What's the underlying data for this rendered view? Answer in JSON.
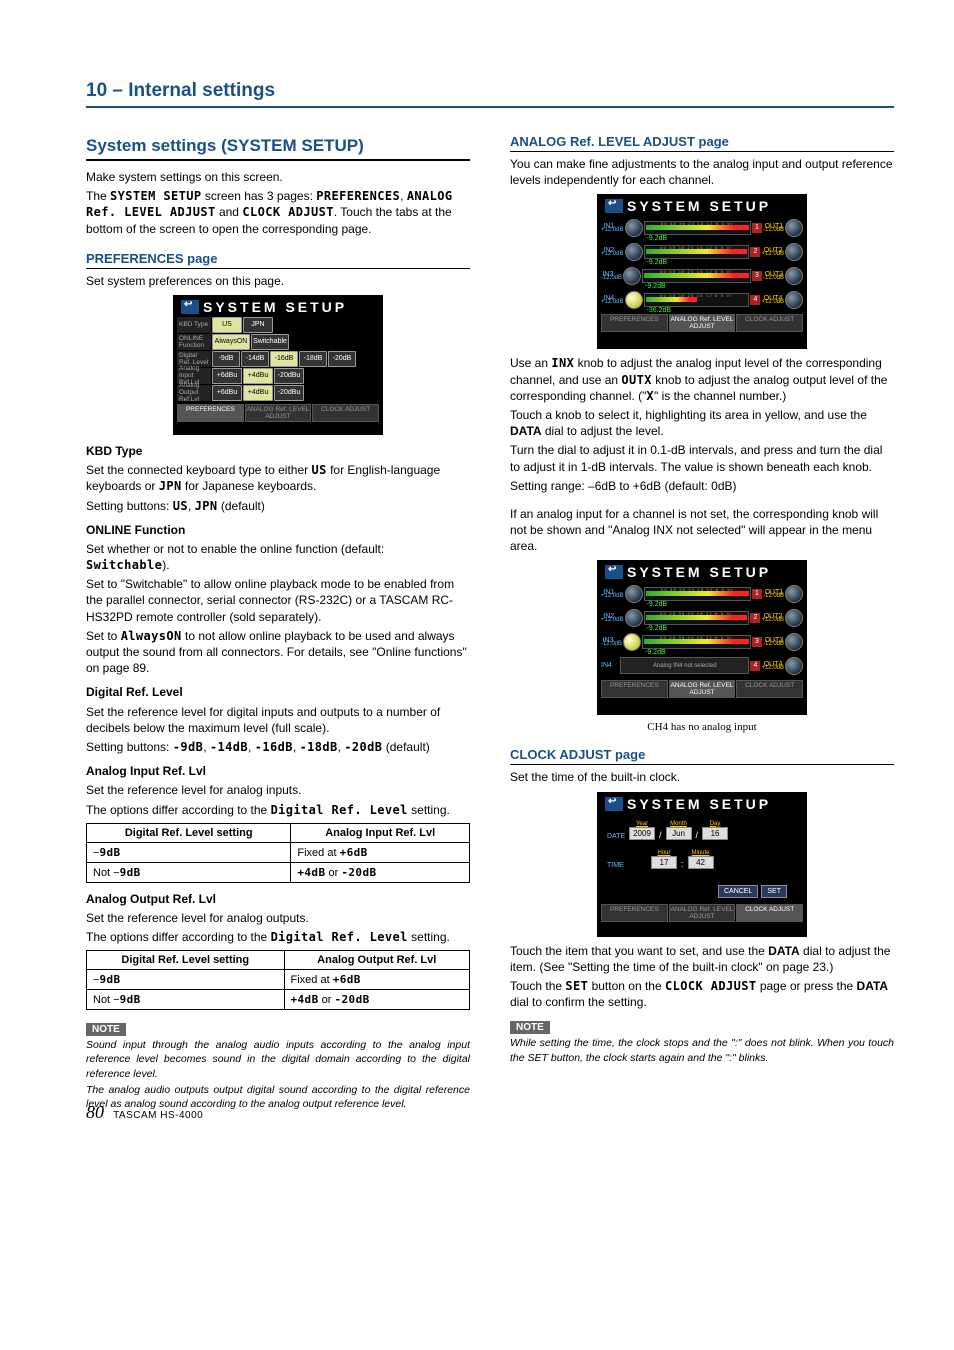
{
  "chapter": "10 – Internal settings",
  "page_number": "80",
  "footer_model": "TASCAM HS-4000",
  "left": {
    "section_title": "System settings (SYSTEM SETUP)",
    "intro1": "Make system settings on this screen.",
    "intro2_a": "The ",
    "intro2_b": "SYSTEM SETUP",
    "intro2_c": " screen has 3 pages: ",
    "intro2_d": "PREFERENCES",
    "intro2_e": ", ",
    "intro2_f": "ANALOG Ref. LEVEL ADJUST",
    "intro2_g": " and ",
    "intro2_h": "CLOCK ADJUST",
    "intro2_i": ". Touch the tabs at the bottom of the screen to open the corresponding page.",
    "prefs_heading": "PREFERENCES page",
    "prefs_lead": "Set system preferences on this page.",
    "ss_title": "SYSTEM SETUP",
    "prefs_rows": {
      "r0": {
        "label": "KBD Type",
        "b0": "US",
        "b1": "JPN"
      },
      "r1": {
        "label": "ONLINE Function",
        "b0": "AlwaysON",
        "b1": "Switchable"
      },
      "r2": {
        "label": "Digital Ref. Level",
        "b0": "-9dB",
        "b1": "-14dB",
        "b2": "-16dB",
        "b3": "-18dB",
        "b4": "-20dB"
      },
      "r3": {
        "label": "Analog Input Ref.Lvl",
        "b0": "+6dBu",
        "b1": "+4dBu",
        "b2": "-20dBu"
      },
      "r4": {
        "label": "Analog Output Ref.Lvl",
        "b0": "+6dBu",
        "b1": "+4dBu",
        "b2": "-20dBu"
      }
    },
    "tabs": {
      "t0": "PREFERENCES",
      "t1": "ANALOG Ref. LEVEL ADJUST",
      "t2": "CLOCK ADJUST"
    },
    "kbd_head": "KBD Type",
    "kbd_p1a": "Set the connected keyboard type to either ",
    "kbd_p1b": "US",
    "kbd_p1c": " for English-language keyboards or ",
    "kbd_p1d": "JPN",
    "kbd_p1e": " for Japanese keyboards.",
    "kbd_p2a": "Setting buttons: ",
    "kbd_p2b": "US",
    "kbd_p2c": ", ",
    "kbd_p2d": "JPN",
    "kbd_p2e": " (default)",
    "online_head": "ONLINE Function",
    "online_p1a": "Set whether or not to enable the online function (default: ",
    "online_p1b": "Switchable",
    "online_p1c": ").",
    "online_p2": "Set to \"Switchable\" to allow online playback mode to be enabled from the parallel connector, serial connector (RS-232C) or a TASCAM RC-HS32PD remote controller (sold separately).",
    "online_p3a": "Set to ",
    "online_p3b": "AlwaysON",
    "online_p3c": " to not allow online playback to be used and always output the sound from all connectors. For details, see \"Online functions\" on page 89.",
    "digref_head": "Digital Ref. Level",
    "digref_p1": "Set the reference level for digital inputs and outputs to a number of decibels below the maximum level (full scale).",
    "digref_p2a": "Setting buttons: ",
    "digref_p2b": "-9dB",
    "digref_p2c": ", ",
    "digref_p2d": "-14dB",
    "digref_p2e": ", ",
    "digref_p2f": "-16dB",
    "digref_p2g": ", ",
    "digref_p2h": "-18dB",
    "digref_p2i": ", ",
    "digref_p2j": "-20dB",
    "digref_p2k": " (default)",
    "ain_head": "Analog Input Ref. Lvl",
    "ain_p1": "Set the reference level for analog inputs.",
    "ain_p2a": "The options differ according to the ",
    "ain_p2b": "Digital Ref. Level",
    "ain_p2c": " setting.",
    "tab1": {
      "h1": "Digital Ref. Level setting",
      "h2": "Analog Input Ref. Lvl",
      "r1c1_prefix": "−",
      "r1c1": "9dB",
      "r1c2a": "Fixed at ",
      "r1c2b": "+6dB",
      "r2c1a": "Not −",
      "r2c1b": "9dB",
      "r2c2a": "+4dB",
      "r2c2b": " or ",
      "r2c2c": "-20dB"
    },
    "aout_head": "Analog Output Ref. Lvl",
    "aout_p1": "Set the reference level for analog outputs.",
    "aout_p2a": "The options differ according to the ",
    "aout_p2b": "Digital Ref. Level",
    "aout_p2c": " setting.",
    "tab2": {
      "h1": "Digital Ref. Level setting",
      "h2": "Analog Output Ref. Lvl",
      "r1c1_prefix": "−",
      "r1c1": "9dB",
      "r1c2a": "Fixed at ",
      "r1c2b": "+6dB",
      "r2c1a": "Not −",
      "r2c1b": "9dB",
      "r2c2a": "+4dB",
      "r2c2b": " or ",
      "r2c2c": "-20dB"
    },
    "note_label": "NOTE",
    "note1": "Sound input through the analog audio inputs according to the analog input reference level becomes sound in the digital domain according to the digital reference level.",
    "note2": "The analog audio outputs output digital sound according to the digital reference level as analog sound according to the analog output reference level."
  },
  "right": {
    "analog_heading": "ANALOG Ref. LEVEL ADJUST page",
    "analog_lead": "You can make fine adjustments to the analog input and output reference levels independently for each channel.",
    "analog_rows": {
      "in1": "IN1",
      "in2": "IN2",
      "in3": "IN3",
      "in4": "IN4",
      "out1": "OUT1",
      "out2": "OUT2",
      "out3": "OUT3",
      "out4": "OUT4",
      "val1": "-9.2dB",
      "val2": "-9.2dB",
      "val3": "-9.2dB",
      "val4": "-36.2dB",
      "sub_p": "+12.0dB",
      "sub_m": "-12.0dB",
      "ticks": "60 48 36 24 18 12 6 0 Vr"
    },
    "analog_p1a": "Use an ",
    "analog_p1b": "INX",
    "analog_p1c": " knob to adjust the analog input level of the corresponding channel, and use an ",
    "analog_p1d": "OUTX",
    "analog_p1e": " knob to adjust the analog output level of the corresponding channel. (\"",
    "analog_p1f": "X",
    "analog_p1g": "\" is the channel number.)",
    "analog_p2": "Touch a knob to select it, highlighting its area in yellow, and use the ",
    "analog_p2b": "DATA",
    "analog_p2c": " dial to adjust the level.",
    "analog_p3": "Turn the dial to adjust it in 0.1-dB intervals, and press and turn the dial to adjust it in 1-dB intervals. The value is shown beneath each knob.",
    "analog_p4": "Setting range: –6dB to +6dB (default: 0dB)",
    "analog_p5": "If an analog input for a channel is not set, the corresponding knob will not be shown and \"Analog INX not selected\" will appear in the menu area.",
    "analog_notsel": "Analog IN4 not selected",
    "caption1": "CH4 has no analog input",
    "clock_heading": "CLOCK ADJUST page",
    "clock_lead": "Set the time of the built-in clock.",
    "clock": {
      "date_label": "DATE",
      "time_label": "TIME",
      "year_l": "Year",
      "month_l": "Month",
      "day_l": "Day",
      "hour_l": "Hour",
      "minute_l": "Minute",
      "year": "2009",
      "month": "Jun",
      "day": "16",
      "hour": "17",
      "minute": "42",
      "slash": "/",
      "colon": ":",
      "cancel": "CANCEL",
      "set": "SET"
    },
    "clock_p1a": "Touch the item that you want to set, and use the ",
    "clock_p1b": "DATA",
    "clock_p1c": " dial to adjust the item. (See \"Setting the time of the built-in clock\" on page 23.)",
    "clock_p2a": "Touch the ",
    "clock_p2b": "SET",
    "clock_p2c": " button on the ",
    "clock_p2d": "CLOCK ADJUST",
    "clock_p2e": " page or press the ",
    "clock_p2f": "DATA",
    "clock_p2g": " dial to confirm the setting.",
    "note_label": "NOTE",
    "clock_note": "While setting the time, the clock stops and the \":\" does not blink. When you touch the SET button, the clock starts again and the \":\" blinks."
  }
}
